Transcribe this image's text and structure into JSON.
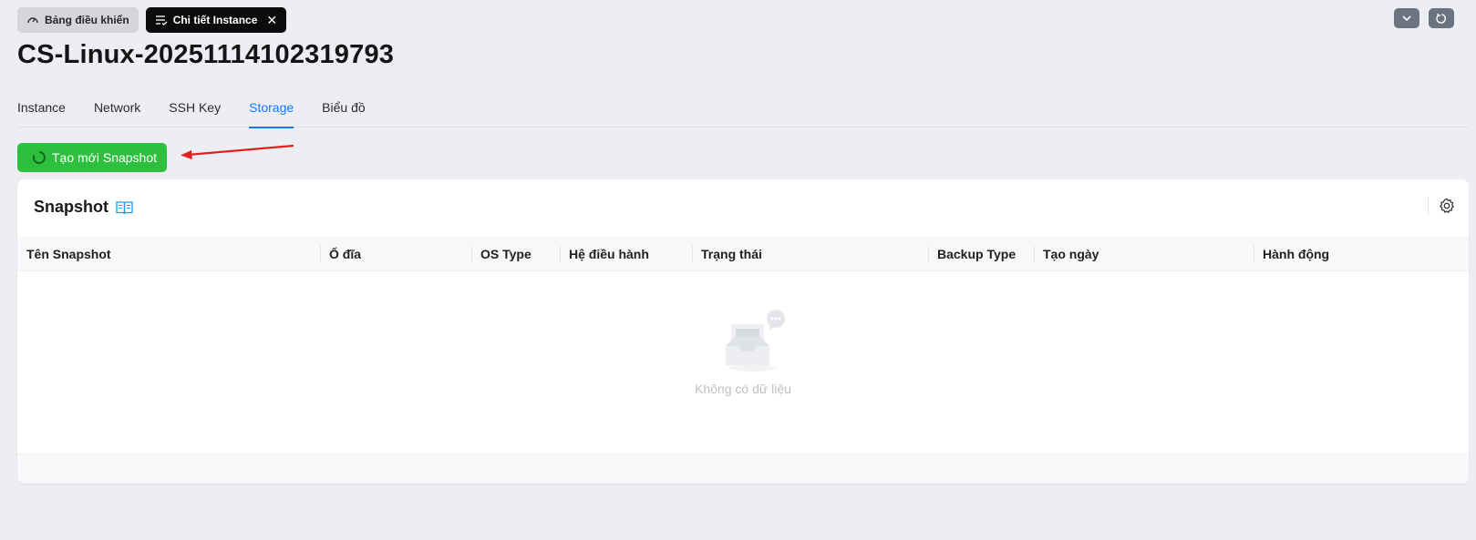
{
  "tabs": [
    {
      "label": "Bảng điều khiển",
      "icon": "dashboard-icon",
      "active": false
    },
    {
      "label": "Chi tiết Instance",
      "icon": "list-check-icon",
      "active": true
    }
  ],
  "title": "CS-Linux-20251114102319793",
  "subtabs": [
    "Instance",
    "Network",
    "SSH Key",
    "Storage",
    "Biểu đồ"
  ],
  "active_subtab": "Storage",
  "create_button": {
    "label": "Tạo mới Snapshot",
    "icon": "loading-spinner-icon"
  },
  "card": {
    "title": "Snapshot",
    "title_icon": "book-icon",
    "settings_icon": "gear-icon",
    "columns": [
      "Tên Snapshot",
      "Ổ đĩa",
      "OS Type",
      "Hệ điều hành",
      "Trạng thái",
      "Backup Type",
      "Tạo ngày",
      "Hành động"
    ],
    "empty_text": "Không có dữ liệu"
  },
  "colors": {
    "primary": "#1677ff",
    "success": "#2fbf3e",
    "annotation_arrow": "#e02020"
  }
}
